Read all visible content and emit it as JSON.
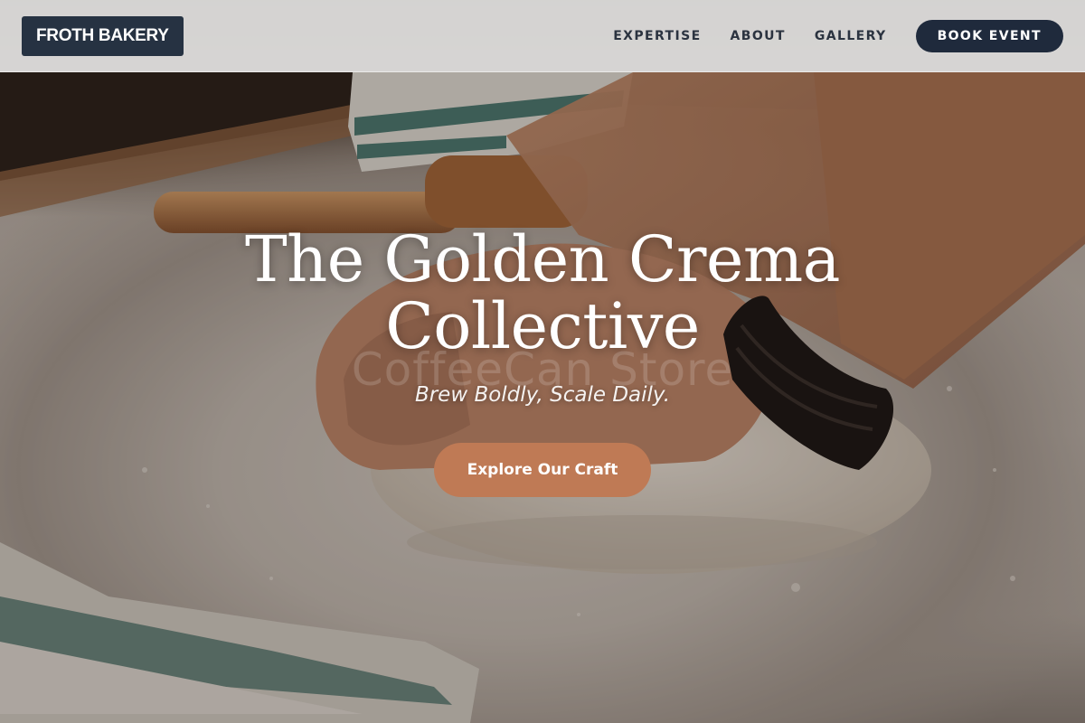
{
  "brand": {
    "logo_text": "FROTH BAKERY"
  },
  "nav": {
    "items": [
      {
        "label": "EXPERTISE"
      },
      {
        "label": "ABOUT"
      },
      {
        "label": "GALLERY"
      }
    ],
    "book_label": "BOOK EVENT"
  },
  "hero": {
    "title_line1": "The Golden Crema",
    "title_line2": "Collective",
    "watermark": "CoffeeCan Store",
    "tagline": "Brew Boldly, Scale Daily.",
    "cta_label": "Explore Our Craft"
  },
  "colors": {
    "logo_bg": "#263242",
    "book_button_bg": "#1f2a3c",
    "cta_bg": "#bf7a55",
    "nav_text": "#2b3340"
  }
}
